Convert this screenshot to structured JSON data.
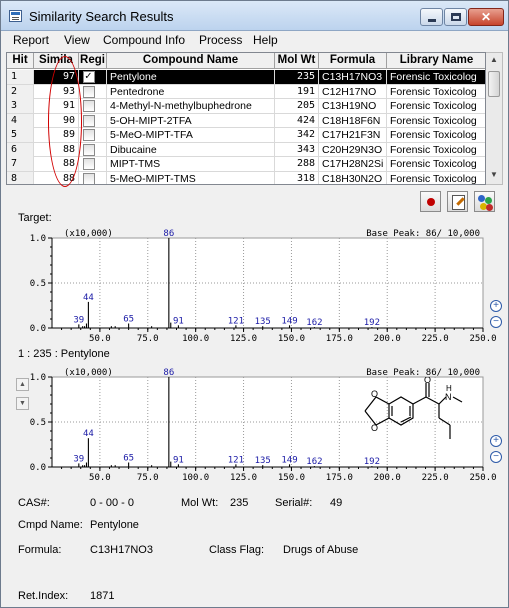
{
  "window": {
    "title": "Similarity Search Results"
  },
  "menu": [
    "Report",
    "View",
    "Compound Info",
    "Process",
    "Help"
  ],
  "table": {
    "headers": [
      "Hit",
      "Simila",
      "Regi",
      "Compound Name",
      "Mol Wt",
      "Formula",
      "Library Name"
    ],
    "rows": [
      {
        "hit": "1",
        "sim": "97",
        "reg": true,
        "name": "Pentylone",
        "mw": "235",
        "formula": "C13H17NO3",
        "lib": "Forensic Toxicolog"
      },
      {
        "hit": "2",
        "sim": "93",
        "reg": false,
        "name": "Pentedrone",
        "mw": "191",
        "formula": "C12H17NO",
        "lib": "Forensic Toxicolog"
      },
      {
        "hit": "3",
        "sim": "91",
        "reg": false,
        "name": "4-Methyl-N-methylbuphedrone",
        "mw": "205",
        "formula": "C13H19NO",
        "lib": "Forensic Toxicolog"
      },
      {
        "hit": "4",
        "sim": "90",
        "reg": false,
        "name": "5-OH-MIPT-2TFA",
        "mw": "424",
        "formula": "C18H18F6N",
        "lib": "Forensic Toxicolog"
      },
      {
        "hit": "5",
        "sim": "89",
        "reg": false,
        "name": "5-MeO-MIPT-TFA",
        "mw": "342",
        "formula": "C17H21F3N",
        "lib": "Forensic Toxicolog"
      },
      {
        "hit": "6",
        "sim": "88",
        "reg": false,
        "name": "Dibucaine",
        "mw": "343",
        "formula": "C20H29N3O",
        "lib": "Forensic Toxicolog"
      },
      {
        "hit": "7",
        "sim": "88",
        "reg": false,
        "name": "MIPT-TMS",
        "mw": "288",
        "formula": "C17H28N2Si",
        "lib": "Forensic Toxicolog"
      },
      {
        "hit": "8",
        "sim": "88",
        "reg": false,
        "name": "5-MeO-MIPT-TMS",
        "mw": "318",
        "formula": "C18H30N2O",
        "lib": "Forensic Toxicolog"
      }
    ],
    "selected_index": 0
  },
  "target_label": "Target:",
  "hit_label": "1 : 235 : Pentylone",
  "spectrum_scale": "(x10,000)",
  "base_peak": "Base Peak: 86/ 10,000",
  "colors": {
    "peak_label": "#1a1aa6",
    "axis": "#000000",
    "grid": "#9a9a9a",
    "oval": "#d10000"
  },
  "chart_data": [
    {
      "type": "bar",
      "title": "Target:",
      "xlabel": "",
      "ylabel": "",
      "xlim": [
        25,
        250
      ],
      "ylim": [
        0,
        1.0
      ],
      "xticks": [
        "50.0",
        "75.0",
        "100.0",
        "125.0",
        "150.0",
        "175.0",
        "200.0",
        "225.0",
        "250.0"
      ],
      "yticks": [
        "0.0",
        "0.5",
        "1.0"
      ],
      "peaks": [
        {
          "mz": 39,
          "i": 0.04,
          "label": "39"
        },
        {
          "mz": 41,
          "i": 0.02,
          "label": ""
        },
        {
          "mz": 42,
          "i": 0.02,
          "label": ""
        },
        {
          "mz": 43,
          "i": 0.05,
          "label": ""
        },
        {
          "mz": 44,
          "i": 0.29,
          "label": "44"
        },
        {
          "mz": 56,
          "i": 0.02,
          "label": ""
        },
        {
          "mz": 58,
          "i": 0.02,
          "label": ""
        },
        {
          "mz": 65,
          "i": 0.05,
          "label": "65"
        },
        {
          "mz": 77,
          "i": 0.02,
          "label": ""
        },
        {
          "mz": 86,
          "i": 1.0,
          "label": "86"
        },
        {
          "mz": 87,
          "i": 0.06,
          "label": ""
        },
        {
          "mz": 91,
          "i": 0.03,
          "label": "91"
        },
        {
          "mz": 121,
          "i": 0.03,
          "label": "121"
        },
        {
          "mz": 135,
          "i": 0.02,
          "label": "135"
        },
        {
          "mz": 149,
          "i": 0.03,
          "label": "149"
        },
        {
          "mz": 162,
          "i": 0.01,
          "label": "162"
        },
        {
          "mz": 192,
          "i": 0.01,
          "label": "192"
        }
      ]
    },
    {
      "type": "bar",
      "title": "1 : 235 : Pentylone",
      "xlabel": "",
      "ylabel": "",
      "xlim": [
        25,
        250
      ],
      "ylim": [
        0,
        1.0
      ],
      "xticks": [
        "50.0",
        "75.0",
        "100.0",
        "125.0",
        "150.0",
        "175.0",
        "200.0",
        "225.0",
        "250.0"
      ],
      "yticks": [
        "0.0",
        "0.5",
        "1.0"
      ],
      "peaks": [
        {
          "mz": 39,
          "i": 0.04,
          "label": "39"
        },
        {
          "mz": 41,
          "i": 0.02,
          "label": ""
        },
        {
          "mz": 42,
          "i": 0.02,
          "label": ""
        },
        {
          "mz": 43,
          "i": 0.05,
          "label": ""
        },
        {
          "mz": 44,
          "i": 0.32,
          "label": "44"
        },
        {
          "mz": 56,
          "i": 0.02,
          "label": ""
        },
        {
          "mz": 58,
          "i": 0.02,
          "label": ""
        },
        {
          "mz": 65,
          "i": 0.05,
          "label": "65"
        },
        {
          "mz": 77,
          "i": 0.02,
          "label": ""
        },
        {
          "mz": 86,
          "i": 1.0,
          "label": "86"
        },
        {
          "mz": 87,
          "i": 0.06,
          "label": ""
        },
        {
          "mz": 91,
          "i": 0.03,
          "label": "91"
        },
        {
          "mz": 121,
          "i": 0.03,
          "label": "121"
        },
        {
          "mz": 135,
          "i": 0.02,
          "label": "135"
        },
        {
          "mz": 149,
          "i": 0.03,
          "label": "149"
        },
        {
          "mz": 162,
          "i": 0.01,
          "label": "162"
        },
        {
          "mz": 192,
          "i": 0.01,
          "label": "192"
        }
      ]
    }
  ],
  "details": {
    "cas_label": "CAS#:",
    "cas": "0 - 00 - 0",
    "molwt_label": "Mol Wt:",
    "molwt": "235",
    "serial_label": "Serial#:",
    "serial": "49",
    "cmpd_label": "Cmpd Name:",
    "cmpd": "Pentylone",
    "formula_label": "Formula:",
    "formula": "C13H17NO3",
    "class_label": "Class Flag:",
    "class": "Drugs of Abuse",
    "ret_label": "Ret.Index:",
    "ret": "1871"
  },
  "icons": {
    "app": "app-window-icon",
    "record": "record-icon",
    "edit": "edit-report-icon",
    "molecule": "molecule-icon",
    "zoom_in": "zoom-in-icon",
    "zoom_out": "zoom-out-icon"
  }
}
